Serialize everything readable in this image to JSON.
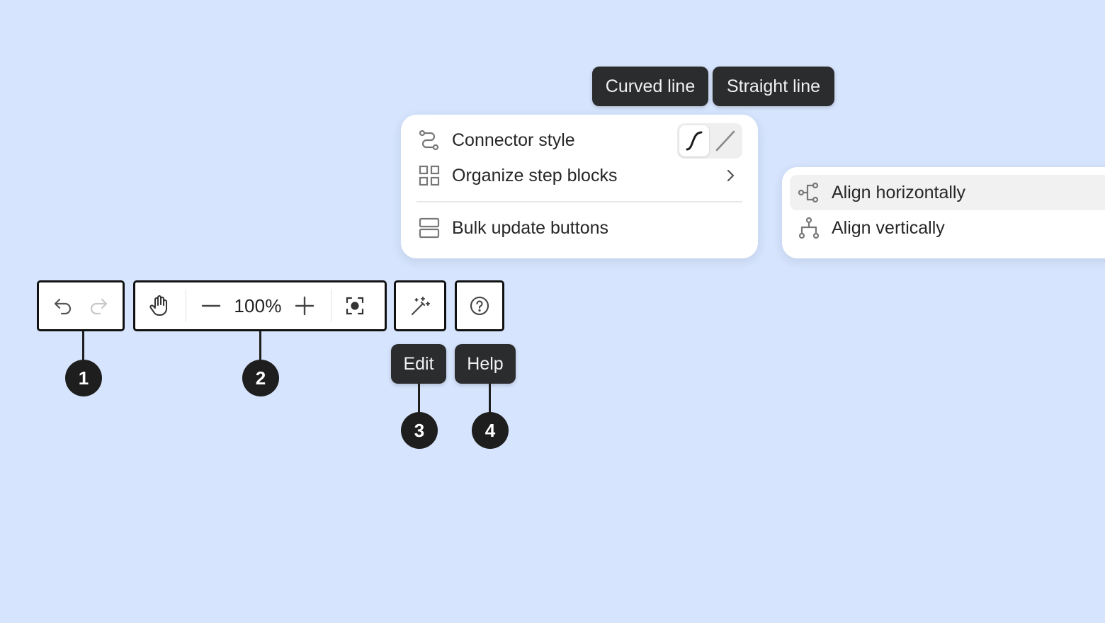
{
  "toolbar": {
    "history": {
      "undo_icon": "undo-icon",
      "redo_icon": "redo-icon"
    },
    "zoom": {
      "value": "100%",
      "hand_icon": "hand-icon",
      "zoom_out_icon": "minus-icon",
      "zoom_in_icon": "plus-icon",
      "fit_icon": "fit-to-screen-icon"
    },
    "edit_icon": "magic-wand-icon",
    "help_icon": "help-circle-icon"
  },
  "tooltips": {
    "curved_line": "Curved line",
    "straight_line": "Straight line",
    "edit": "Edit",
    "help": "Help"
  },
  "callouts": [
    "1",
    "2",
    "3",
    "4"
  ],
  "edit_menu": {
    "items": [
      {
        "label": "Connector style",
        "icon": "connector-icon"
      },
      {
        "label": "Organize step blocks",
        "icon": "grid-icon",
        "chevron": "chevron-right-icon"
      },
      {
        "label": "Bulk update buttons",
        "icon": "rows-icon"
      }
    ],
    "connector_options": [
      {
        "name": "curved",
        "icon": "curved-line-icon",
        "selected": true
      },
      {
        "name": "straight",
        "icon": "straight-line-icon",
        "selected": false
      }
    ]
  },
  "organize_submenu": {
    "items": [
      {
        "label": "Align horizontally",
        "icon": "align-horizontal-icon",
        "highlighted": true
      },
      {
        "label": "Align vertically",
        "icon": "align-vertical-icon",
        "highlighted": false
      }
    ]
  },
  "colors": {
    "background": "#d6e4fd",
    "tooltip": "#2b2c2e",
    "badge": "#1e1e1e",
    "highlight": "#f1f1f1"
  }
}
